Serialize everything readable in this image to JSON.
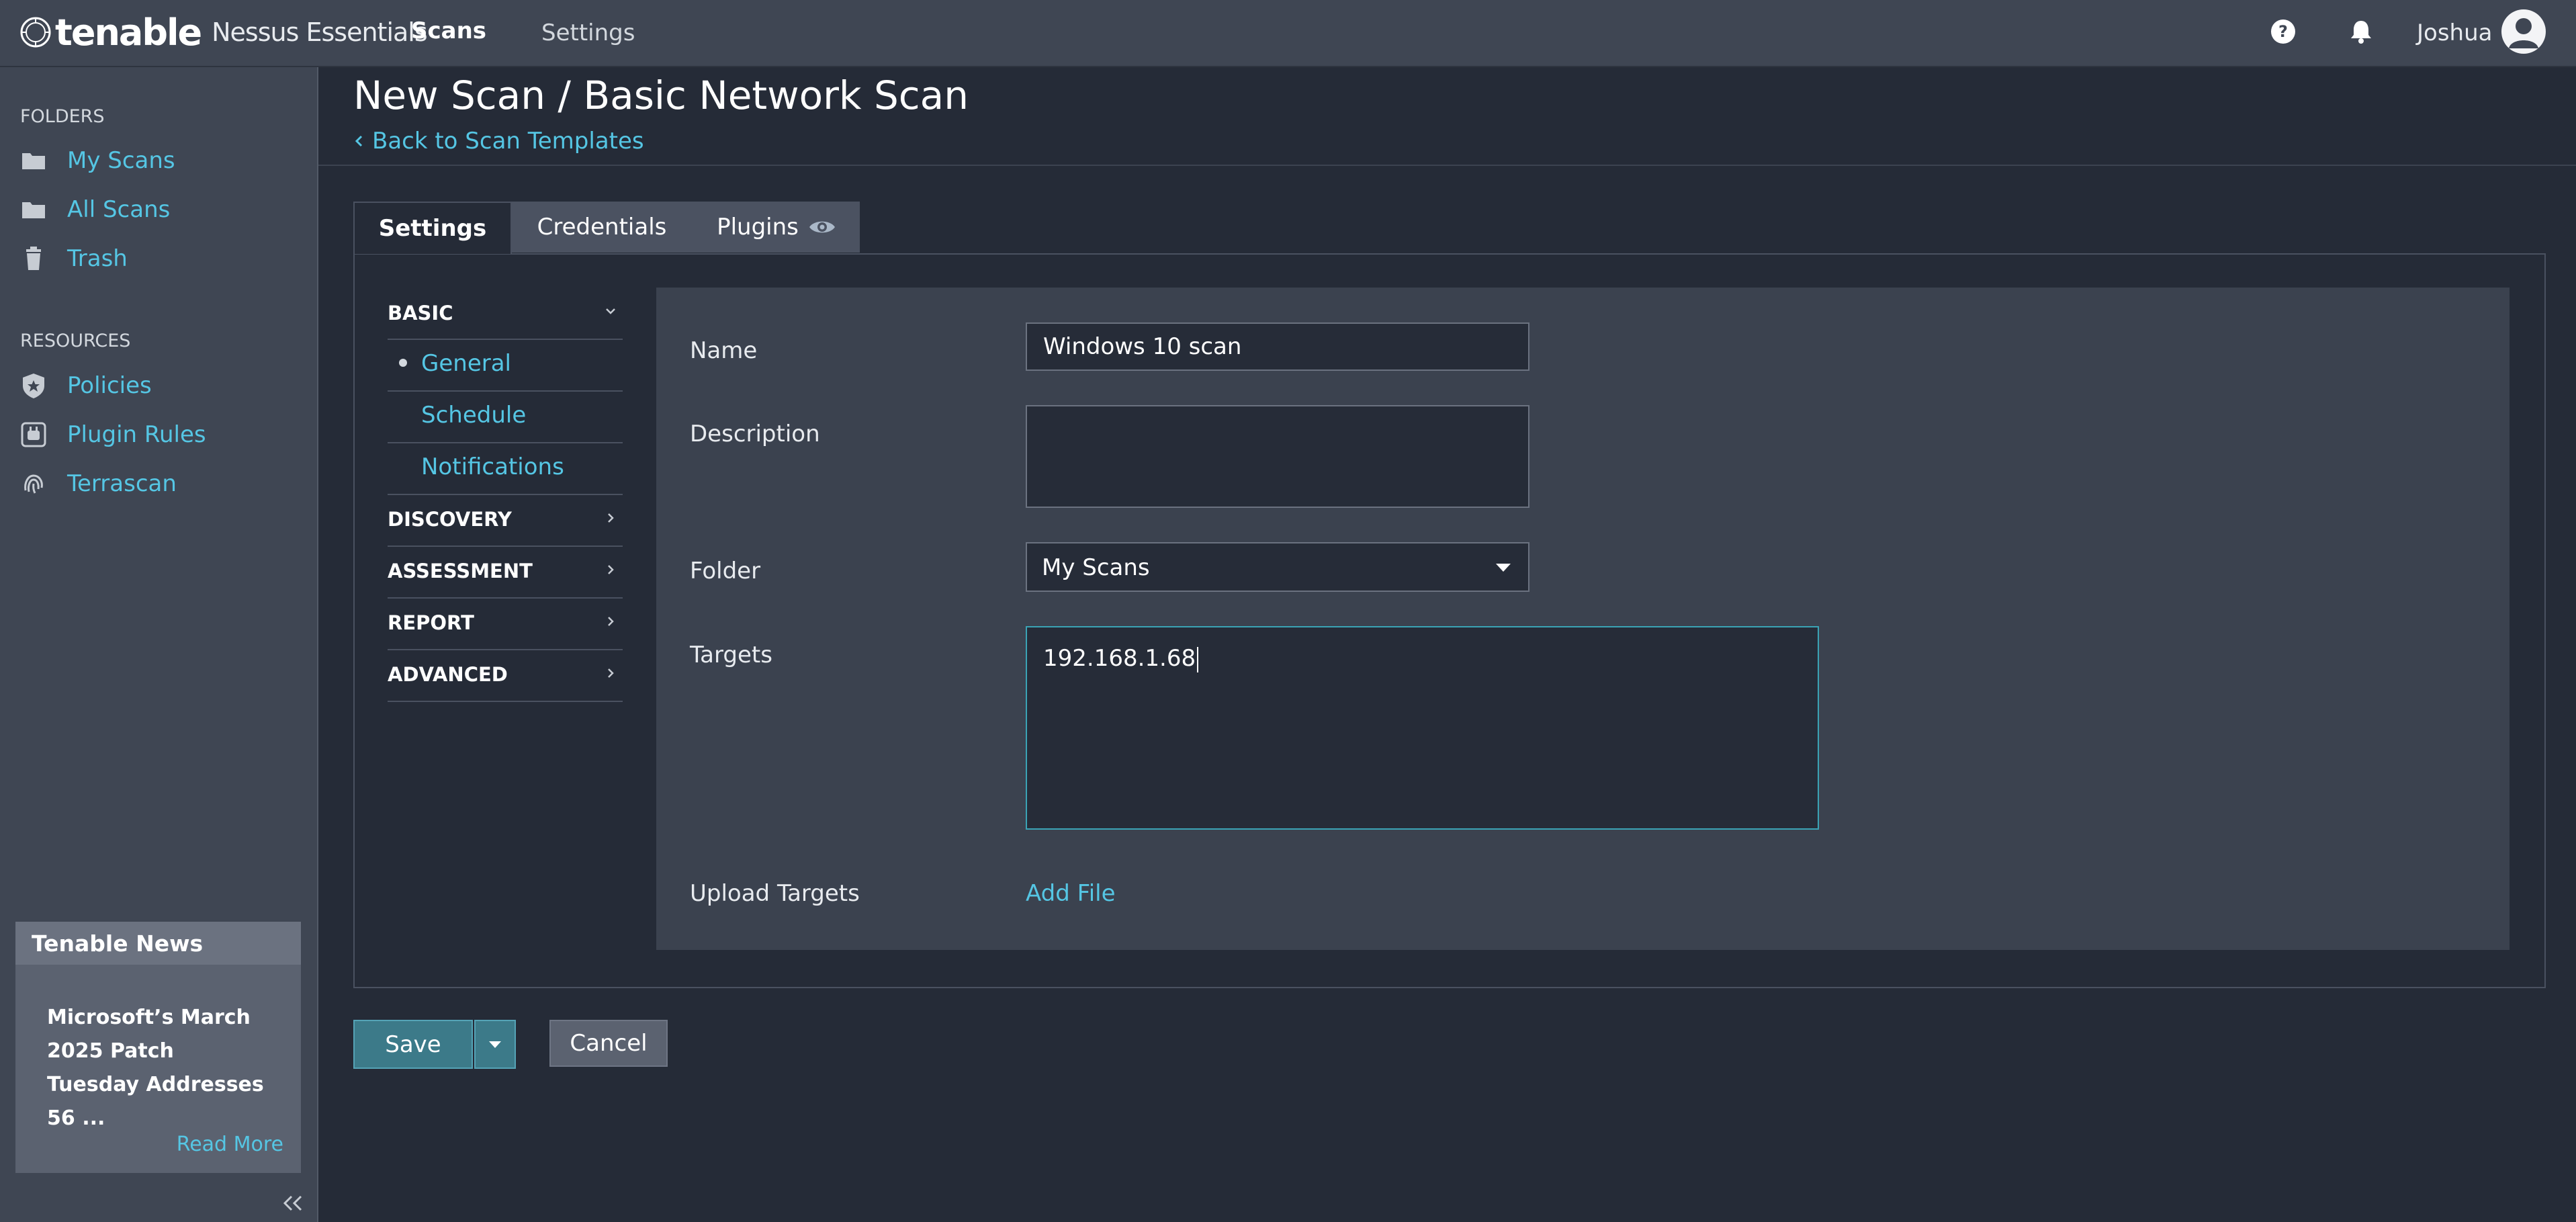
{
  "app": {
    "brand": "tenable",
    "product": "Nessus Essentials"
  },
  "topnav": {
    "scans": "Scans",
    "settings": "Settings",
    "user": "Joshua"
  },
  "sidebar": {
    "folders_heading": "FOLDERS",
    "folders": [
      {
        "label": "My Scans",
        "icon": "folder-icon"
      },
      {
        "label": "All Scans",
        "icon": "folder-icon"
      },
      {
        "label": "Trash",
        "icon": "trash-icon"
      }
    ],
    "resources_heading": "RESOURCES",
    "resources": [
      {
        "label": "Policies",
        "icon": "shield-icon"
      },
      {
        "label": "Plugin Rules",
        "icon": "plug-icon"
      },
      {
        "label": "Terrascan",
        "icon": "fingerprint-icon"
      }
    ],
    "news": {
      "title": "Tenable News",
      "headline": "Microsoft’s March 2025 Patch Tuesday Addresses 56 ...",
      "read_more": "Read More"
    }
  },
  "page": {
    "title": "New Scan / Basic Network Scan",
    "back_link": "Back to Scan Templates"
  },
  "tabs": [
    {
      "label": "Settings",
      "active": true
    },
    {
      "label": "Credentials",
      "active": false
    },
    {
      "label": "Plugins",
      "active": false
    }
  ],
  "categories": {
    "basic": "BASIC",
    "basic_items": [
      "General",
      "Schedule",
      "Notifications"
    ],
    "discovery": "DISCOVERY",
    "assessment": "ASSESSMENT",
    "report": "REPORT",
    "advanced": "ADVANCED"
  },
  "form": {
    "name_label": "Name",
    "name_value": "Windows 10 scan",
    "description_label": "Description",
    "description_value": "",
    "folder_label": "Folder",
    "folder_value": "My Scans",
    "targets_label": "Targets",
    "targets_value": "192.168.1.68",
    "upload_label": "Upload Targets",
    "add_file": "Add File"
  },
  "actions": {
    "save": "Save",
    "cancel": "Cancel"
  },
  "colors": {
    "accent_link": "#55c6e4",
    "primary_button": "#3c7a89",
    "background": "#252b37",
    "chrome": "#3f4653"
  }
}
